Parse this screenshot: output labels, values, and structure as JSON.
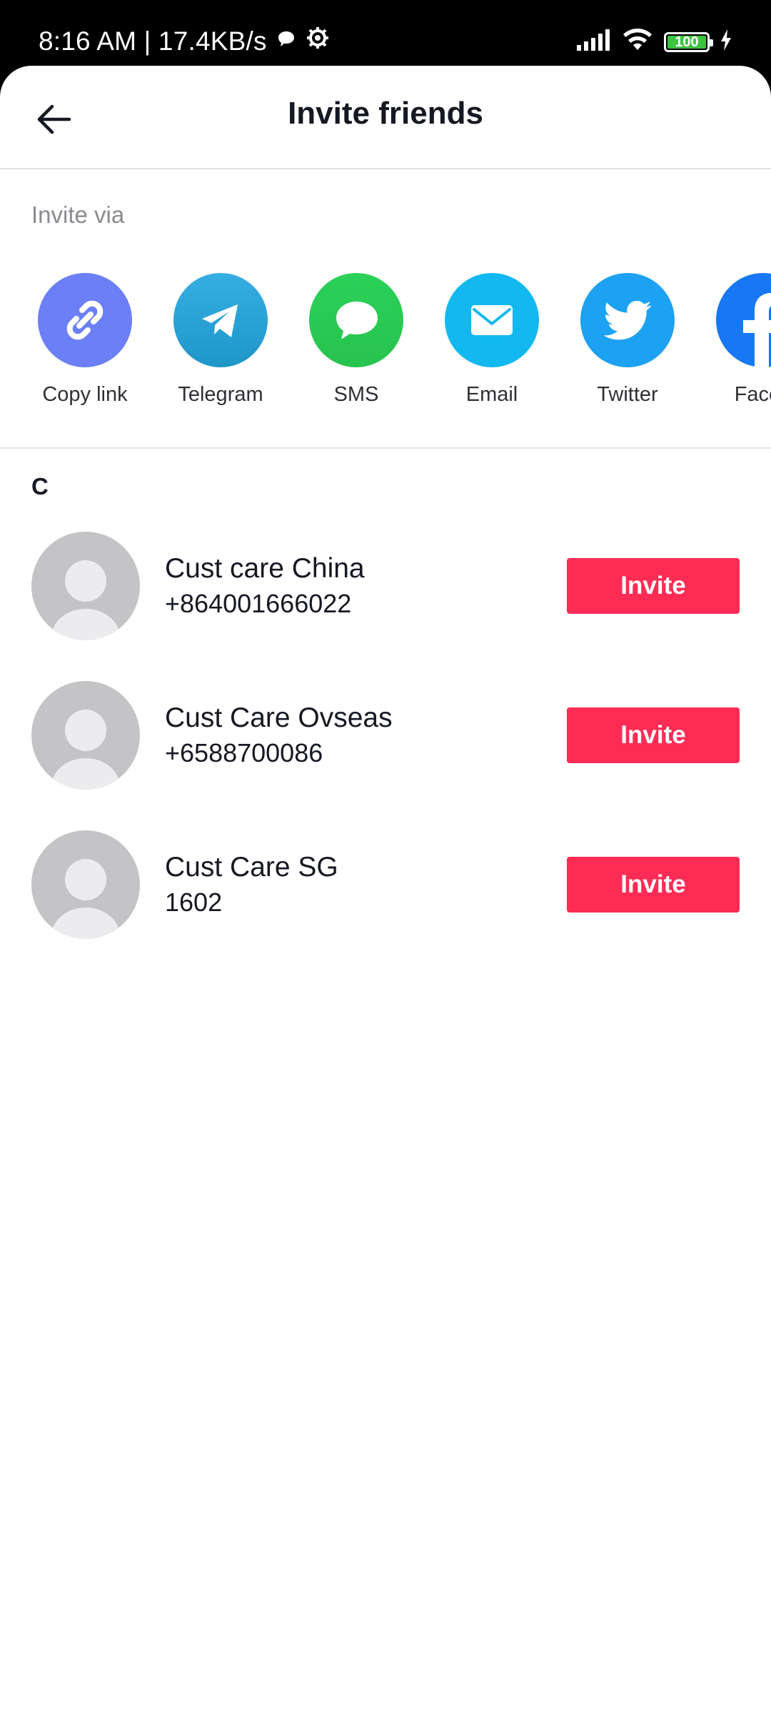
{
  "status_bar": {
    "time_speed": "8:16 AM | 17.4KB/s",
    "battery": "100"
  },
  "header": {
    "title": "Invite friends"
  },
  "invite_via": {
    "label": "Invite via",
    "options": [
      {
        "label": "Copy link",
        "icon": "link-icon",
        "color": "#6b7ff7"
      },
      {
        "label": "Telegram",
        "icon": "telegram-icon",
        "color": "#2a9fd6"
      },
      {
        "label": "SMS",
        "icon": "message-bubble-icon",
        "color": "#2bd158"
      },
      {
        "label": "Email",
        "icon": "envelope-icon",
        "color": "#12b8f0"
      },
      {
        "label": "Twitter",
        "icon": "twitter-bird-icon",
        "color": "#1da1f2"
      },
      {
        "label": "Faceb",
        "icon": "facebook-icon",
        "color": "#1877f2"
      }
    ]
  },
  "contacts": {
    "section_letter": "C",
    "items": [
      {
        "name": "Cust care China",
        "phone": "+864001666022",
        "button": "Invite"
      },
      {
        "name": "Cust Care Ovseas",
        "phone": "+6588700086",
        "button": "Invite"
      },
      {
        "name": "Cust Care SG",
        "phone": "1602",
        "button": "Invite"
      }
    ]
  },
  "colors": {
    "accent": "#fe2c55",
    "avatar_bg": "#c4c4c6"
  }
}
